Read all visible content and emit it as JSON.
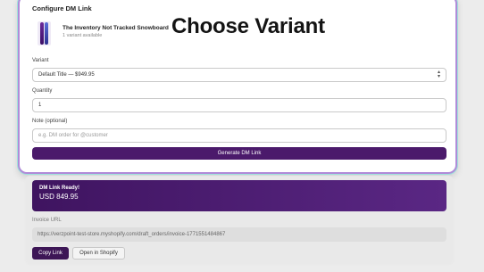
{
  "overlay": {
    "title": "Choose Variant"
  },
  "dialog": {
    "title": "Configure DM Link",
    "product": {
      "name": "The Inventory Not Tracked Snowboard",
      "variants_available": "1 variant available"
    },
    "variant": {
      "label": "Variant",
      "value": "Default Title — $949.95"
    },
    "quantity": {
      "label": "Quantity",
      "value": "1"
    },
    "note": {
      "label": "Note (optional)",
      "placeholder": "e.g. DM order for @customer"
    },
    "generate_label": "Generate DM Link"
  },
  "result": {
    "ready_title": "DM Link Ready!",
    "amount": "USD 849.95",
    "invoice_label": "Invoice URL",
    "invoice_url": "https://verzpoint-test-store.myshopify.com/draft_orders/invoice-1771551484867",
    "copy_label": "Copy Link",
    "open_label": "Open in Shopify"
  },
  "colors": {
    "accent": "#4b1a6b",
    "card_border": "#b08bd8",
    "card_glow": "#9fe3dc"
  }
}
